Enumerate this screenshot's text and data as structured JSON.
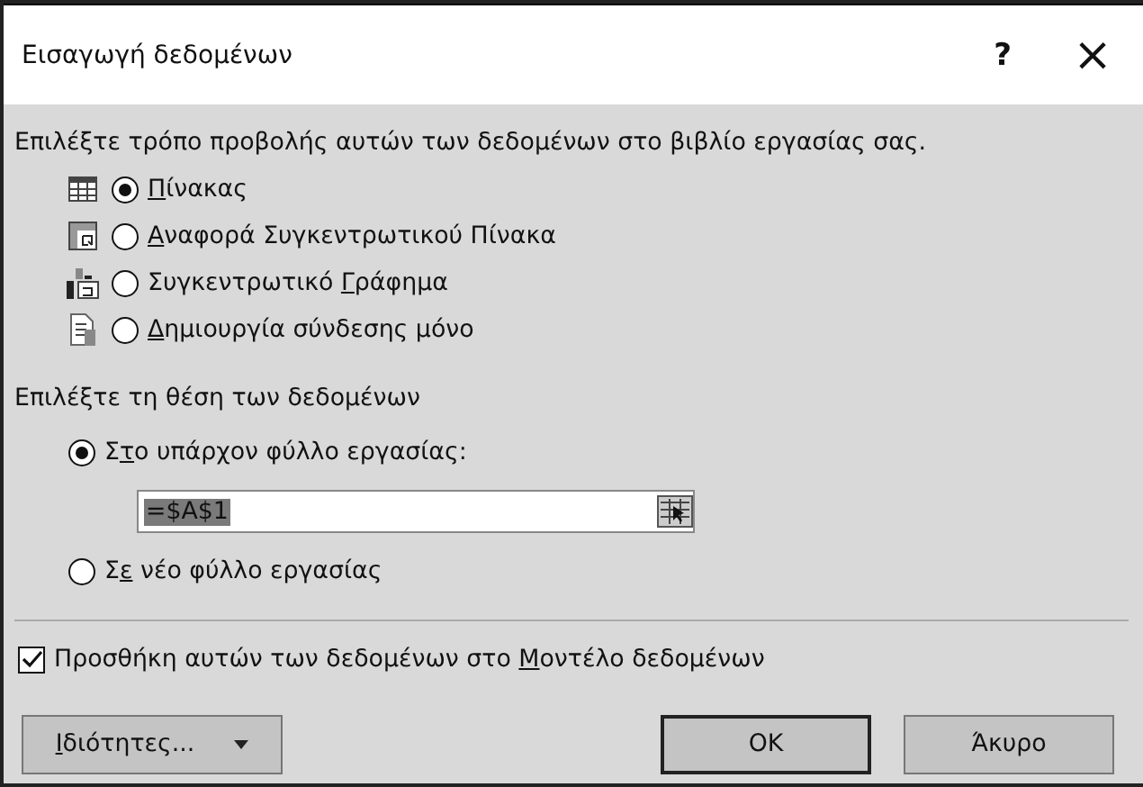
{
  "window": {
    "title": "Εισαγωγή δεδομένων",
    "help": "?",
    "close": "×"
  },
  "view_prompt": "Επιλέξτε τρόπο προβολής αυτών των δεδομένων στο βιβλίο εργασίας σας.",
  "view_options": [
    {
      "kind": "table",
      "key": "Π",
      "after": "ίνακας",
      "selected": true
    },
    {
      "kind": "pivot",
      "key": "Α",
      "after": "ναφορά Συγκεντρωτικού Πίνακα",
      "selected": false
    },
    {
      "kind": "pivotchart",
      "before": "Συγκεντρωτικό ",
      "key": "Γ",
      "after": "ράφημα",
      "selected": false
    },
    {
      "kind": "connection",
      "key": "Δ",
      "after": "ημιουργία σύνδεσης μόνο",
      "selected": false
    }
  ],
  "location_prompt": "Επιλέξτε τη θέση των δεδομένων",
  "location_options": [
    {
      "before": "Σ",
      "key": "τ",
      "after": "ο υπάρχον φύλλο εργασίας:",
      "selected": true,
      "field": {
        "value": "=$A$1"
      }
    },
    {
      "before": "Σ",
      "key": "ε",
      "after": " νέο φύλλο εργασίας",
      "selected": false
    }
  ],
  "data_model": {
    "before": "Προσθήκη αυτών των δεδομένων στο ",
    "key": "Μ",
    "after": "οντέλο δεδομένων",
    "checked": true
  },
  "buttons": [
    {
      "kind": "dropdown",
      "key": "Ι",
      "after": "διότητες..."
    },
    {
      "kind": "default",
      "after": "OK"
    },
    {
      "kind": "plain",
      "after": "Άκυρο"
    }
  ]
}
